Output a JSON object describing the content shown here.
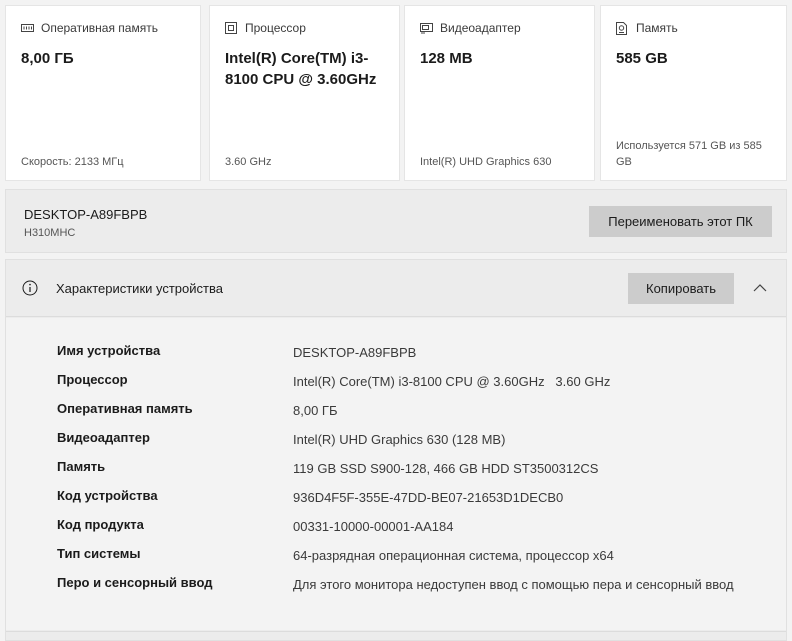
{
  "cards": [
    {
      "label": "Оперативная память",
      "icon": "ram-icon",
      "value": "8,00 ГБ",
      "foot": "Скорость: 2133 МГц"
    },
    {
      "label": "Процессор",
      "icon": "cpu-icon",
      "value": "Intel(R) Core(TM) i3-8100 CPU @ 3.60GHz",
      "foot": "3.60 GHz"
    },
    {
      "label": "Видеоадаптер",
      "icon": "gpu-icon",
      "value": "128 MB",
      "foot": "Intel(R) UHD Graphics 630"
    },
    {
      "label": "Память",
      "icon": "storage-icon",
      "value": "585 GB",
      "foot": "Используется 571 GB из 585 GB"
    }
  ],
  "device": {
    "name": "DESKTOP-A89FBPB",
    "model": "H310MHC",
    "rename_label": "Переименовать этот ПК"
  },
  "specs": {
    "title": "Характеристики устройства",
    "copy_label": "Копировать",
    "rows": [
      {
        "label": "Имя устройства",
        "value": "DESKTOP-A89FBPB"
      },
      {
        "label": "Процессор",
        "value": "Intel(R) Core(TM) i3-8100 CPU @ 3.60GHz   3.60 GHz"
      },
      {
        "label": "Оперативная память",
        "value": "8,00 ГБ"
      },
      {
        "label": "Видеоадаптер",
        "value": "Intel(R) UHD Graphics 630 (128 MB)"
      },
      {
        "label": "Память",
        "value": "119 GB SSD S900-128, 466 GB HDD ST3500312CS"
      },
      {
        "label": "Код устройства",
        "value": "936D4F5F-355E-47DD-BE07-21653D1DECB0"
      },
      {
        "label": "Код продукта",
        "value": "00331-10000-00001-AA184"
      },
      {
        "label": "Тип системы",
        "value": "64-разрядная операционная система, процессор x64"
      },
      {
        "label": "Перо и сенсорный ввод",
        "value": "Для этого монитора недоступен ввод с помощью пера и сенсорный ввод"
      }
    ]
  }
}
